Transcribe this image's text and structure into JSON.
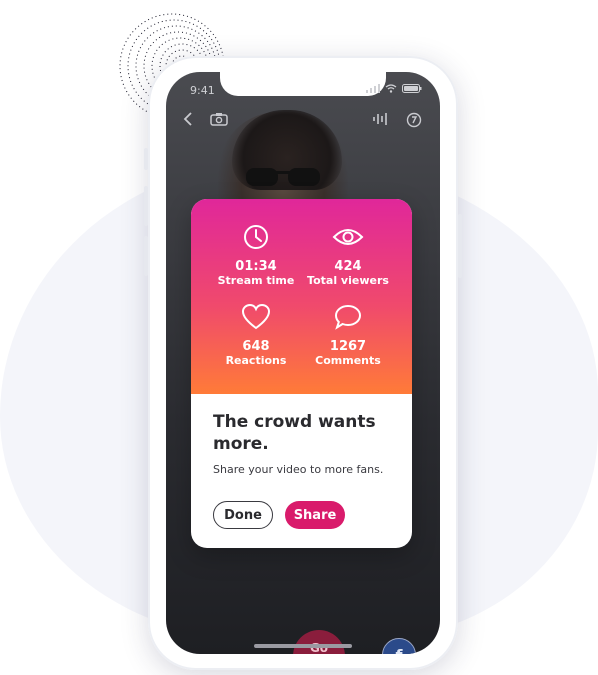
{
  "status": {
    "time": "9:41"
  },
  "stats": [
    {
      "icon": "clock-icon",
      "value": "01:34",
      "label": "Stream time"
    },
    {
      "icon": "eye-icon",
      "value": "424",
      "label": "Total viewers"
    },
    {
      "icon": "heart-icon",
      "value": "648",
      "label": "Reactions"
    },
    {
      "icon": "comment-icon",
      "value": "1267",
      "label": "Comments"
    }
  ],
  "card": {
    "headline": "The crowd wants more.",
    "subtext": "Share your video to more fans.",
    "done_label": "Done",
    "share_label": "Share"
  },
  "controls": {
    "go_live_label": "Go live",
    "avatar_letter": "f"
  },
  "colors": {
    "gradient_top": "#e0279a",
    "gradient_bottom": "#ff7b38",
    "share_button": "#d91b6b",
    "go_live": "#8a1d3c"
  }
}
